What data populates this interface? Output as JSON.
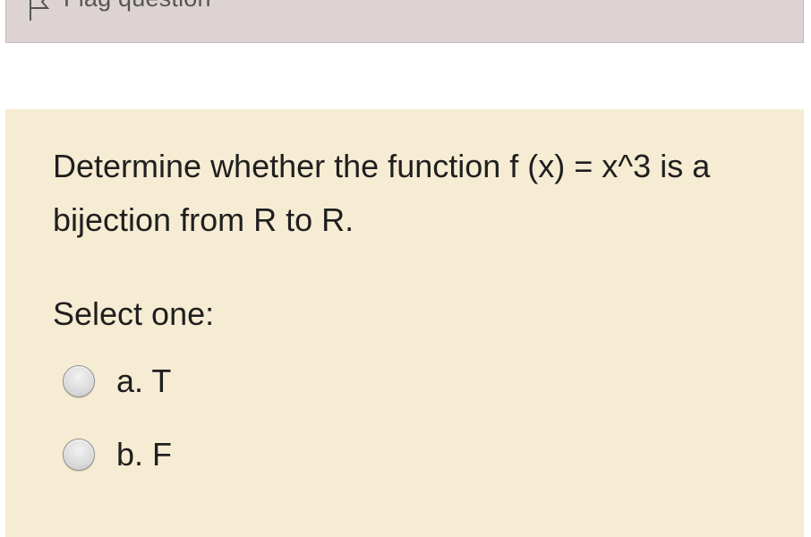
{
  "flag": {
    "icon": "flag-icon",
    "label": "Flag question"
  },
  "question": {
    "text": "Determine whether the function f (x) = x^3 is a bijection from R to R.",
    "prompt": "Select one:",
    "options": [
      {
        "label": "a. T",
        "selected": false
      },
      {
        "label": "b. F",
        "selected": false
      }
    ]
  },
  "colors": {
    "flag_bar_bg": "#ddd3d3",
    "question_bg": "#f6ecd3",
    "text": "#1f1f1f"
  }
}
